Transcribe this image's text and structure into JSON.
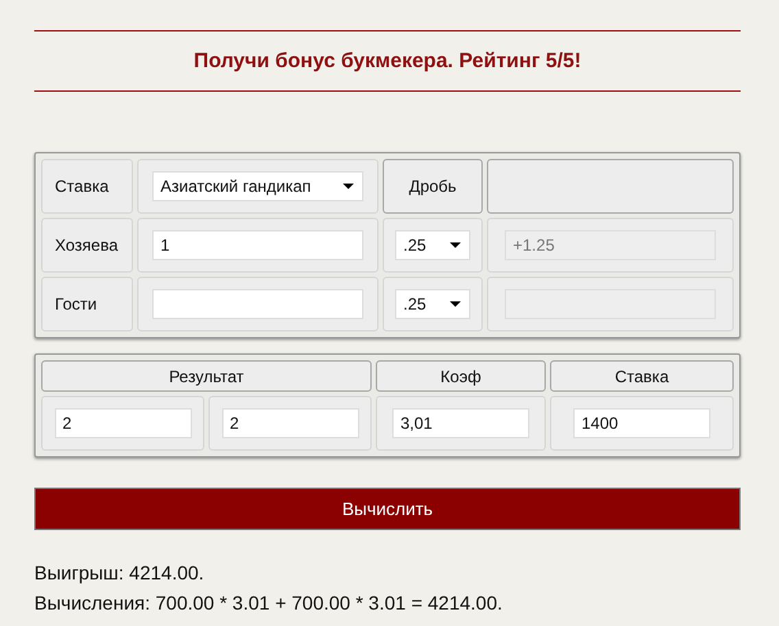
{
  "banner": {
    "title": "Получи бонус букмекера. Рейтинг 5/5!"
  },
  "handicap_table": {
    "stake_label": "Ставка",
    "bet_type": "Азиатский гандикап",
    "fraction_header": "Дробь",
    "rows": [
      {
        "label": "Хозяева",
        "value": "1",
        "fraction": ".25",
        "result": "+1.25",
        "result_disabled": true
      },
      {
        "label": "Гости",
        "fraction": ".25",
        "result_disabled": true
      }
    ]
  },
  "result_table": {
    "headers": [
      "Результат",
      "Коэф",
      "Ставка"
    ],
    "score": [
      "2",
      "2"
    ],
    "odds": "3,01",
    "stake": "1400"
  },
  "calculate_button": "Вычислить",
  "output": [
    "Выигрыш: 4214.00.",
    "Вычисления: 700.00 * 3.01 + 700.00 * 3.01 = 4214.00."
  ]
}
